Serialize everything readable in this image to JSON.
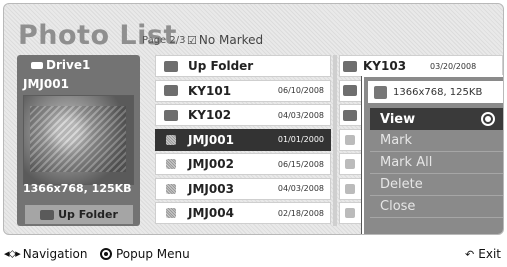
{
  "header": {
    "title": "Photo List",
    "page_info": "Page 2/3",
    "mark_status": "No Marked"
  },
  "drive": {
    "label": "Drive1",
    "file_name": "JMJ001",
    "resolution": "1366x768, 125KB",
    "up_folder_label": "Up Folder"
  },
  "list": [
    {
      "name": "Up Folder",
      "date": "",
      "type": "folder"
    },
    {
      "name": "KY101",
      "date": "06/10/2008",
      "type": "folder"
    },
    {
      "name": "KY102",
      "date": "04/03/2008",
      "type": "folder"
    },
    {
      "name": "JMJ001",
      "date": "01/01/2000",
      "type": "file"
    },
    {
      "name": "JMJ002",
      "date": "06/15/2008",
      "type": "file"
    },
    {
      "name": "JMJ003",
      "date": "04/03/2008",
      "type": "file"
    },
    {
      "name": "JMJ004",
      "date": "02/18/2008",
      "type": "file"
    }
  ],
  "right_list": [
    {
      "name": "KY103",
      "date": "03/20/2008",
      "type": "folder"
    }
  ],
  "popup": {
    "header": "1366x768, 125KB",
    "items": [
      "View",
      "Mark",
      "Mark All",
      "Delete",
      "Close"
    ],
    "active_index": 0
  },
  "footer": {
    "navigation": "Navigation",
    "popup_menu": "Popup Menu",
    "exit": "Exit"
  }
}
